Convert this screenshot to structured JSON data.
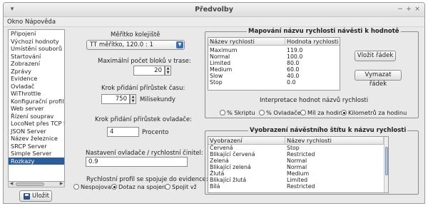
{
  "window": {
    "title": "Předvolby",
    "controls": [
      "−",
      "+",
      "×"
    ]
  },
  "menu": [
    "Okno",
    "Nápověda"
  ],
  "sidebar": {
    "items": [
      "Připojení",
      "Výchozí hodnoty",
      "Umístění souborů",
      "Startování",
      "Zobrazení",
      "Zprávy",
      "Evidence",
      "Ovladač",
      "WiThrottle",
      "Konfigurační profily",
      "Web server",
      "Řízení souprav",
      "LocoNet přes TCP Se",
      "JSON Server",
      "Název železnice",
      "SRCP Server",
      "Simple Server",
      "Rozkazy"
    ],
    "selected_index": 17
  },
  "save_button": "Uložit",
  "settings": {
    "scale_label": "Měřítko kolejiště",
    "scale_value": "TT měřítko, 120.0 : 1",
    "max_blocks_label": "Maximální počet bloků v trase:",
    "max_blocks_value": "20",
    "speed_step_label": "Krok přidání přírůstek času:",
    "speed_step_value": "750",
    "speed_step_unit": "Milisekundy",
    "throttle_step_label": "Krok přidání přírůstek ovladače:",
    "throttle_step_value": "4",
    "throttle_step_unit": "Procento",
    "throttle_factor_label": "Nastavení ovladače / rychlostní činitel:",
    "throttle_factor_value": "0.9",
    "profile_label": "Rychlostní profil se spojuje do evidence:",
    "profile_options": [
      "Nespojovat",
      "Dotaz na spojení",
      "Spojit vždy"
    ],
    "profile_selected": 1
  },
  "mapping": {
    "legend": "Mapování názvu rychlosti návěsti k hodnotě",
    "columns": [
      "Název rychlosti",
      "Hodnota rychlosti"
    ],
    "rows": [
      [
        "Maximum",
        "119.0"
      ],
      [
        "Normal",
        "100.0"
      ],
      [
        "Limited",
        "80.0"
      ],
      [
        "Medium",
        "60.0"
      ],
      [
        "Slow",
        "40.0"
      ],
      [
        "Stop",
        "0.0"
      ]
    ],
    "add_button": "Vložit řádek",
    "delete_button": "Vymazat řádek",
    "interp_label": "Interpretace hodnot názvů rychlosti",
    "interp_options": [
      "% Skriptu",
      "% Ovladače",
      "Míl za hodinu",
      "Kilometrů za hodinu"
    ],
    "interp_selected": 3
  },
  "display": {
    "legend": "Vyobrazení návěstního štítu k názvu rychlosti",
    "columns": [
      "Vyobrazení",
      "Název rychlosti"
    ],
    "rows": [
      [
        "Červená",
        "Stop"
      ],
      [
        "Blikající červená",
        "Restricted"
      ],
      [
        "Zelená",
        "Normal"
      ],
      [
        "Blikající zelená",
        "Normal"
      ],
      [
        "Žlutá",
        "Medium"
      ],
      [
        "Blikající žlutá",
        "Limited"
      ],
      [
        "Bílá",
        "Restricted"
      ]
    ]
  }
}
